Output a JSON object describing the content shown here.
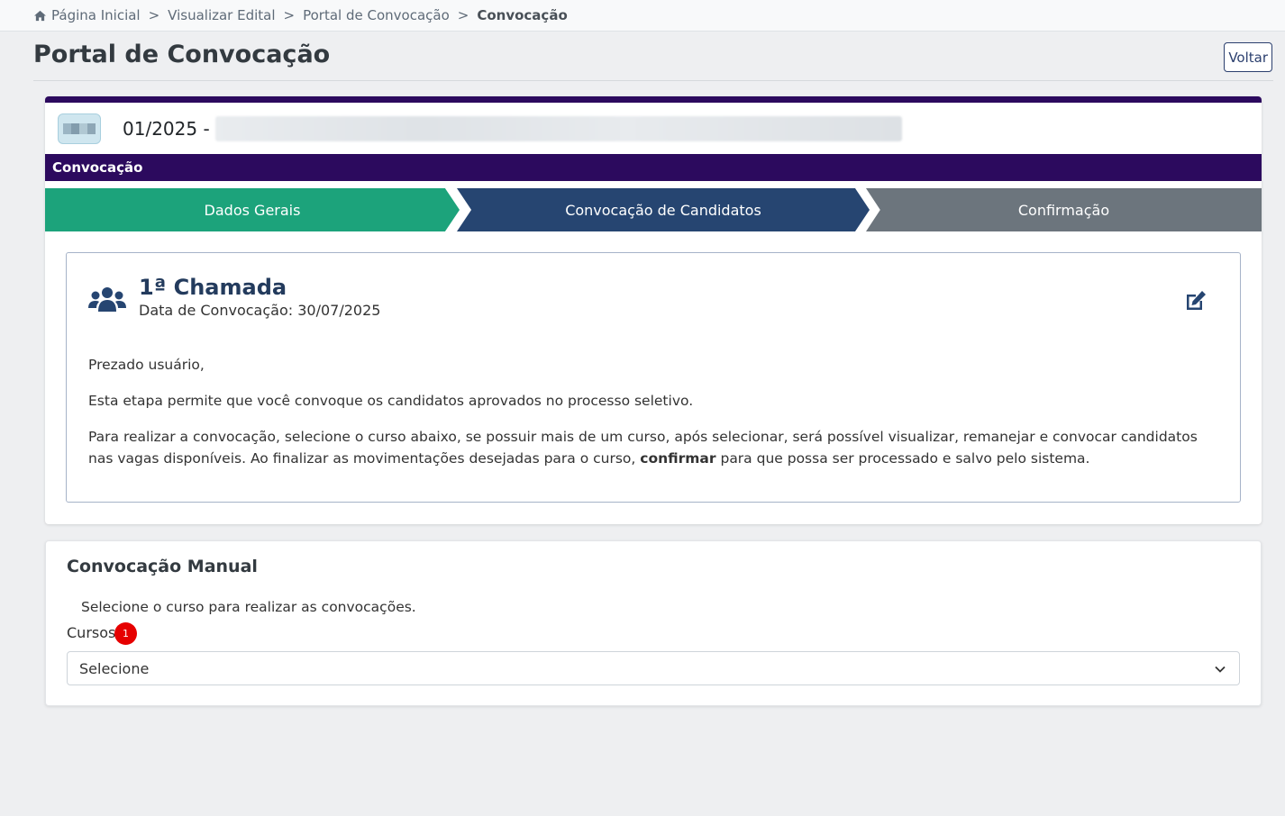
{
  "breadcrumb": {
    "items": [
      "Página Inicial",
      "Visualizar Edital",
      "Portal de Convocação"
    ],
    "current": "Convocação",
    "separator": ">"
  },
  "header": {
    "title": "Portal de Convocação",
    "back_label": "Voltar"
  },
  "edital": {
    "number": "01/2025 -"
  },
  "section": {
    "label": "Convocação"
  },
  "steps": [
    {
      "label": "Dados Gerais",
      "color": "#1ca37b"
    },
    {
      "label": "Convocação de Candidatos",
      "color": "#264571"
    },
    {
      "label": "Confirmação",
      "color": "#6c757d"
    }
  ],
  "call": {
    "title": "1ª Chamada",
    "date": "Data de Convocação: 30/07/2025",
    "icon": "users-group-icon",
    "edit_icon": "edit-icon"
  },
  "info": {
    "greeting": "Prezado usuário,",
    "paragraph1": "Esta etapa permite que você convoque os candidatos aprovados no processo seletivo.",
    "paragraph2_start": "Para realizar a convocação, selecione o curso abaixo, se possuir mais de um curso, após selecionar, será possível visualizar, remanejar e convocar candidatos nas vagas disponíveis. Ao finalizar as movimentações desejadas para o curso, ",
    "paragraph2_bold": "confirmar",
    "paragraph2_end": " para que possa ser processado e salvo pelo sistema."
  },
  "manual": {
    "title": "Convocação Manual",
    "hint": "Selecione o curso para realizar as convocações.",
    "courses_label": "Cursos",
    "courses_badge": "1",
    "select_value": "Selecione"
  },
  "colors": {
    "brand_purple": "#2c0a5e",
    "accent_navy": "#264571",
    "success_green": "#1ca37b",
    "badge_red": "#e60000"
  }
}
